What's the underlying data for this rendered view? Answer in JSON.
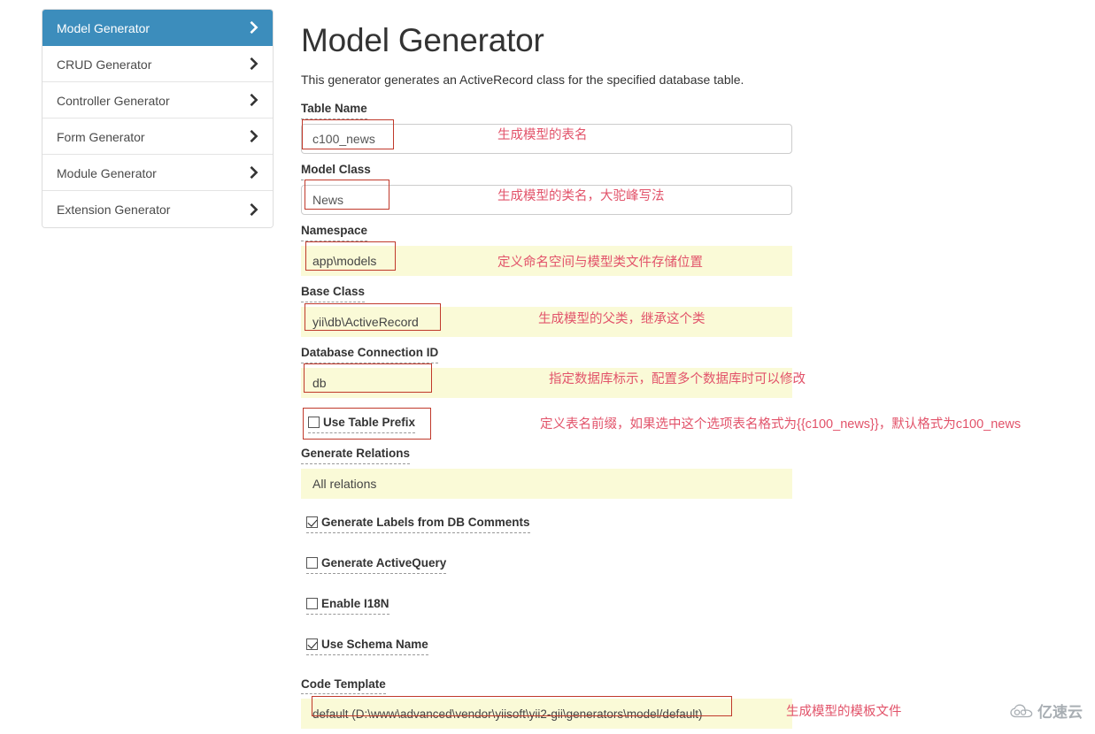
{
  "sidebar": {
    "items": [
      {
        "label": "Model Generator",
        "active": true,
        "icon": "chevron-right-icon"
      },
      {
        "label": "CRUD Generator",
        "active": false,
        "icon": "chevron-right-icon"
      },
      {
        "label": "Controller Generator",
        "active": false,
        "icon": "chevron-right-icon"
      },
      {
        "label": "Form Generator",
        "active": false,
        "icon": "chevron-right-icon"
      },
      {
        "label": "Module Generator",
        "active": false,
        "icon": "chevron-right-icon"
      },
      {
        "label": "Extension Generator",
        "active": false,
        "icon": "chevron-right-icon"
      }
    ]
  },
  "page": {
    "title": "Model Generator",
    "description": "This generator generates an ActiveRecord class for the specified database table."
  },
  "fields": {
    "table_name": {
      "label": "Table Name",
      "value": "c100_news"
    },
    "model_class": {
      "label": "Model Class",
      "value": "News"
    },
    "namespace": {
      "label": "Namespace",
      "value": "app\\models"
    },
    "base_class": {
      "label": "Base Class",
      "value": "yii\\db\\ActiveRecord"
    },
    "db_id": {
      "label": "Database Connection ID",
      "value": "db"
    },
    "relations": {
      "label": "Generate Relations",
      "value": "All relations"
    },
    "code_template": {
      "label": "Code Template",
      "value": "default (D:\\www\\advanced\\vendor\\yiisoft\\yii2-gii\\generators\\model/default)"
    }
  },
  "checkboxes": {
    "use_table_prefix": {
      "label": "Use Table Prefix",
      "checked": false
    },
    "generate_labels": {
      "label": "Generate Labels from DB Comments",
      "checked": true
    },
    "generate_query": {
      "label": "Generate ActiveQuery",
      "checked": false
    },
    "enable_i18n": {
      "label": "Enable I18N",
      "checked": false
    },
    "use_schema_name": {
      "label": "Use Schema Name",
      "checked": true
    }
  },
  "annotations": {
    "table_name": "生成模型的表名",
    "model_class": "生成模型的类名，大驼峰写法",
    "namespace": "定义命名空间与模型类文件存储位置",
    "base_class": "生成模型的父类，继承这个类",
    "db_id": "指定数据库标示，配置多个数据库时可以修改",
    "table_prefix": "定义表名前缀，如果选中这个选项表名格式为{{c100_news}}，默认格式为c100_news",
    "code_template": "生成模型的模板文件"
  },
  "watermark": {
    "text": "亿速云",
    "icon": "cloud-icon"
  },
  "colors": {
    "accent": "#3c8dbc",
    "annotation_red": "#e2536a",
    "redbox_border": "#c0392b",
    "autofill_yellow": "#fafad7"
  }
}
